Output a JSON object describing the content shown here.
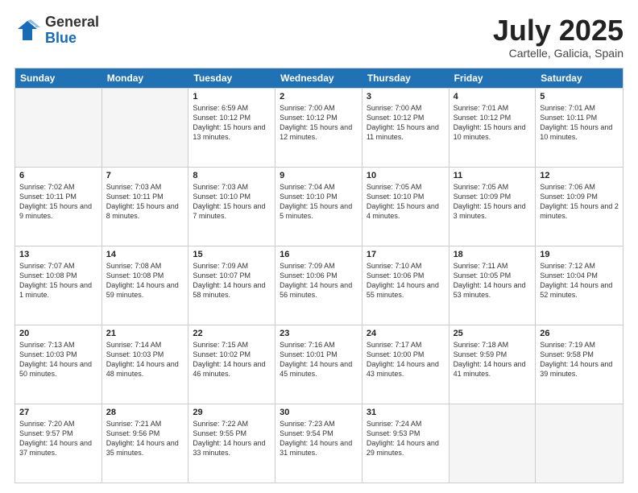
{
  "logo": {
    "general": "General",
    "blue": "Blue"
  },
  "title": "July 2025",
  "location": "Cartelle, Galicia, Spain",
  "days_of_week": [
    "Sunday",
    "Monday",
    "Tuesday",
    "Wednesday",
    "Thursday",
    "Friday",
    "Saturday"
  ],
  "weeks": [
    [
      {
        "day": "",
        "info": ""
      },
      {
        "day": "",
        "info": ""
      },
      {
        "day": "1",
        "info": "Sunrise: 6:59 AM\nSunset: 10:12 PM\nDaylight: 15 hours and 13 minutes."
      },
      {
        "day": "2",
        "info": "Sunrise: 7:00 AM\nSunset: 10:12 PM\nDaylight: 15 hours and 12 minutes."
      },
      {
        "day": "3",
        "info": "Sunrise: 7:00 AM\nSunset: 10:12 PM\nDaylight: 15 hours and 11 minutes."
      },
      {
        "day": "4",
        "info": "Sunrise: 7:01 AM\nSunset: 10:12 PM\nDaylight: 15 hours and 10 minutes."
      },
      {
        "day": "5",
        "info": "Sunrise: 7:01 AM\nSunset: 10:11 PM\nDaylight: 15 hours and 10 minutes."
      }
    ],
    [
      {
        "day": "6",
        "info": "Sunrise: 7:02 AM\nSunset: 10:11 PM\nDaylight: 15 hours and 9 minutes."
      },
      {
        "day": "7",
        "info": "Sunrise: 7:03 AM\nSunset: 10:11 PM\nDaylight: 15 hours and 8 minutes."
      },
      {
        "day": "8",
        "info": "Sunrise: 7:03 AM\nSunset: 10:10 PM\nDaylight: 15 hours and 7 minutes."
      },
      {
        "day": "9",
        "info": "Sunrise: 7:04 AM\nSunset: 10:10 PM\nDaylight: 15 hours and 5 minutes."
      },
      {
        "day": "10",
        "info": "Sunrise: 7:05 AM\nSunset: 10:10 PM\nDaylight: 15 hours and 4 minutes."
      },
      {
        "day": "11",
        "info": "Sunrise: 7:05 AM\nSunset: 10:09 PM\nDaylight: 15 hours and 3 minutes."
      },
      {
        "day": "12",
        "info": "Sunrise: 7:06 AM\nSunset: 10:09 PM\nDaylight: 15 hours and 2 minutes."
      }
    ],
    [
      {
        "day": "13",
        "info": "Sunrise: 7:07 AM\nSunset: 10:08 PM\nDaylight: 15 hours and 1 minute."
      },
      {
        "day": "14",
        "info": "Sunrise: 7:08 AM\nSunset: 10:08 PM\nDaylight: 14 hours and 59 minutes."
      },
      {
        "day": "15",
        "info": "Sunrise: 7:09 AM\nSunset: 10:07 PM\nDaylight: 14 hours and 58 minutes."
      },
      {
        "day": "16",
        "info": "Sunrise: 7:09 AM\nSunset: 10:06 PM\nDaylight: 14 hours and 56 minutes."
      },
      {
        "day": "17",
        "info": "Sunrise: 7:10 AM\nSunset: 10:06 PM\nDaylight: 14 hours and 55 minutes."
      },
      {
        "day": "18",
        "info": "Sunrise: 7:11 AM\nSunset: 10:05 PM\nDaylight: 14 hours and 53 minutes."
      },
      {
        "day": "19",
        "info": "Sunrise: 7:12 AM\nSunset: 10:04 PM\nDaylight: 14 hours and 52 minutes."
      }
    ],
    [
      {
        "day": "20",
        "info": "Sunrise: 7:13 AM\nSunset: 10:03 PM\nDaylight: 14 hours and 50 minutes."
      },
      {
        "day": "21",
        "info": "Sunrise: 7:14 AM\nSunset: 10:03 PM\nDaylight: 14 hours and 48 minutes."
      },
      {
        "day": "22",
        "info": "Sunrise: 7:15 AM\nSunset: 10:02 PM\nDaylight: 14 hours and 46 minutes."
      },
      {
        "day": "23",
        "info": "Sunrise: 7:16 AM\nSunset: 10:01 PM\nDaylight: 14 hours and 45 minutes."
      },
      {
        "day": "24",
        "info": "Sunrise: 7:17 AM\nSunset: 10:00 PM\nDaylight: 14 hours and 43 minutes."
      },
      {
        "day": "25",
        "info": "Sunrise: 7:18 AM\nSunset: 9:59 PM\nDaylight: 14 hours and 41 minutes."
      },
      {
        "day": "26",
        "info": "Sunrise: 7:19 AM\nSunset: 9:58 PM\nDaylight: 14 hours and 39 minutes."
      }
    ],
    [
      {
        "day": "27",
        "info": "Sunrise: 7:20 AM\nSunset: 9:57 PM\nDaylight: 14 hours and 37 minutes."
      },
      {
        "day": "28",
        "info": "Sunrise: 7:21 AM\nSunset: 9:56 PM\nDaylight: 14 hours and 35 minutes."
      },
      {
        "day": "29",
        "info": "Sunrise: 7:22 AM\nSunset: 9:55 PM\nDaylight: 14 hours and 33 minutes."
      },
      {
        "day": "30",
        "info": "Sunrise: 7:23 AM\nSunset: 9:54 PM\nDaylight: 14 hours and 31 minutes."
      },
      {
        "day": "31",
        "info": "Sunrise: 7:24 AM\nSunset: 9:53 PM\nDaylight: 14 hours and 29 minutes."
      },
      {
        "day": "",
        "info": ""
      },
      {
        "day": "",
        "info": ""
      }
    ]
  ]
}
